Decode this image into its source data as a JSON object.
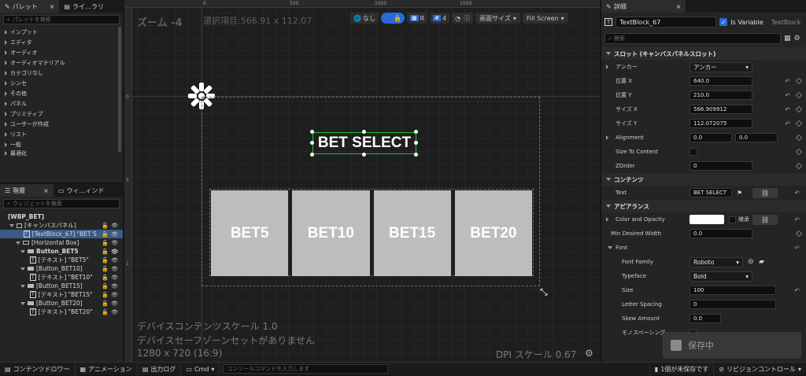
{
  "palette": {
    "tab_label": "パレット",
    "tab2_label": "ライ…ラリ",
    "search_placeholder": "パレットを検索",
    "items": [
      "インプット",
      "エディタ",
      "オーディオ",
      "オーディオマテリアル",
      "カテゴリなし",
      "シンセ",
      "その他",
      "パネル",
      "プリミティブ",
      "ユーザーが作成",
      "リスト",
      "一般",
      "最適化"
    ]
  },
  "hierarchy": {
    "tab_label": "階層",
    "tab2_label": "ウィ…ィンド",
    "search_placeholder": "ウィジェットを検索",
    "rows": [
      {
        "label": "[WBP_BET]"
      },
      {
        "label": "[キャンバスパネル]"
      },
      {
        "label": "[TextBlock_67] \"BET S"
      },
      {
        "label": "[Horizontal Box]"
      },
      {
        "label": "Button_BET5"
      },
      {
        "label": "[テキスト] \"BET5\""
      },
      {
        "label": "[Button_BET10]"
      },
      {
        "label": "[テキスト] \"BET10\""
      },
      {
        "label": "[Button_BET15]"
      },
      {
        "label": "[テキスト] \"BET15\""
      },
      {
        "label": "[Button_BET20]"
      },
      {
        "label": "[テキスト] \"BET20\""
      }
    ]
  },
  "viewport": {
    "zoom": "ズーム -4",
    "selection": "選択項目:566.91 x 112.07",
    "ruler_h": [
      "0",
      "500",
      "1000",
      "1500"
    ],
    "ruler_v": [
      "0",
      "5",
      "1"
    ],
    "toolbar": {
      "none_label": "なし",
      "r_label": "R",
      "grid_value": "4",
      "screen_size_label": "画面サイズ",
      "fill_screen_label": "Fill Screen"
    },
    "title_text": "BET SELECT",
    "buttons": [
      "BET5",
      "BET10",
      "BET15",
      "BET20"
    ],
    "info_line1": "デバイスコンテンツスケール 1.0",
    "info_line2": "デバイスセーフゾーンセットがありません",
    "info_line3": "1280 x 720 (16:9)",
    "dpi": "DPI スケール 0.67"
  },
  "details": {
    "tab_label": "詳細",
    "widget_name": "TextBlock_67",
    "is_variable_label": "Is Variable",
    "class_label": "TextBlock",
    "search_placeholder": "検索",
    "slot_section": "スロット (キャンバスパネルスロット)",
    "anchor_label": "アンカー",
    "anchor_value": "アンカー",
    "pos_x_label": "位置 X",
    "pos_x": "640.0",
    "pos_y_label": "位置 Y",
    "pos_y": "210.0",
    "size_x_label": "サイズ X",
    "size_x": "566.909912",
    "size_y_label": "サイズ Y",
    "size_y": "112.072075",
    "alignment_label": "Alignment",
    "align_x": "0.0",
    "align_y": "0.0",
    "size_to_content_label": "Size To Content",
    "zorder_label": "ZOrder",
    "zorder": "0",
    "content_section": "コンテンツ",
    "text_label": "Text",
    "text_value": "BET SELECT",
    "appearance_section": "アピアランス",
    "color_label": "Color and Opacity",
    "inherit_label": "継承",
    "min_width_label": "Min Desired Width",
    "min_width": "0.0",
    "font_section": "Font",
    "font_family_label": "Font Family",
    "font_family": "Roboto",
    "typeface_label": "Typeface",
    "typeface": "Bold",
    "size_label": "Size",
    "size": "100",
    "letter_spacing_label": "Letter Spacing",
    "letter_spacing": "0",
    "skew_label": "Skew Amount",
    "skew": "0.0",
    "mono_label": "モノスペーシング",
    "saving_label": "保存中"
  },
  "statusbar": {
    "content_drawer": "コンテンツドロワー",
    "animation": "アニメーション",
    "output_log": "出力ログ",
    "cmd": "Cmd",
    "console_placeholder": "コンソールコマンドを入力します",
    "unsaved": "1個が未保存です",
    "revision": "リビジョンコントロール"
  }
}
